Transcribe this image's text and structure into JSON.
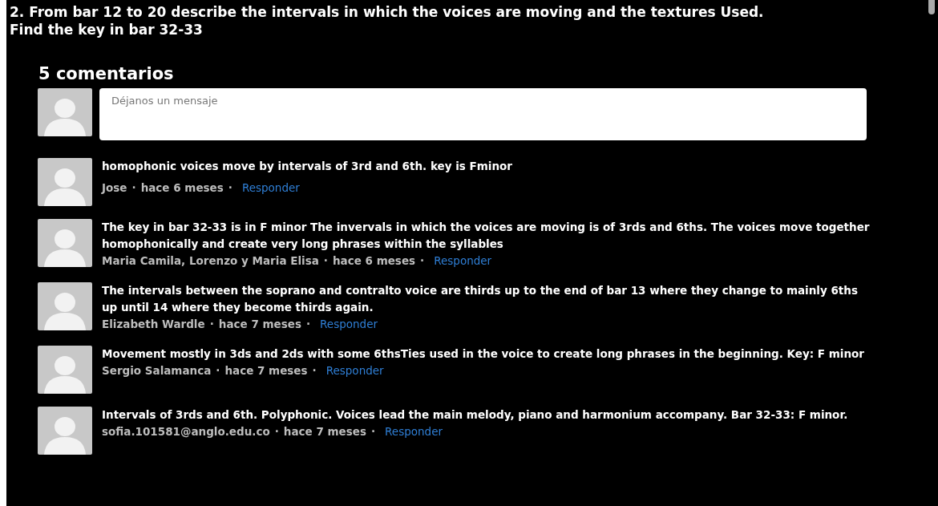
{
  "question": "2. From bar 12 to 20 describe the intervals in which the voices are moving and the textures Used. Find the key in bar 32-33",
  "comments_heading": "5 comentarios",
  "separator": "·",
  "message_field": {
    "placeholder": "Déjanos un mensaje"
  },
  "comments": [
    {
      "text": "homophonic voices move by intervals of 3rd and 6th. key is Fminor",
      "author": "Jose",
      "time": "hace 6 meses",
      "reply": "Responder"
    },
    {
      "text": "The key in bar 32-33 is in F minor The invervals in which the voices are moving is of 3rds and 6ths. The voices move together homophonically and create very long phrases within the syllables",
      "author": "Maria Camila, Lorenzo y Maria Elisa",
      "time": "hace 6 meses",
      "reply": "Responder"
    },
    {
      "text": "The intervals between the soprano and contralto voice are thirds up to the end of bar 13 where they change to mainly 6ths up until 14 where they become thirds again.",
      "author": "Elizabeth Wardle",
      "time": "hace 7 meses",
      "reply": "Responder"
    },
    {
      "text": "Movement mostly in 3ds and 2ds with some 6thsTies used in the voice to create long phrases in the beginning. Key: F minor",
      "author": "Sergio Salamanca",
      "time": "hace 7 meses",
      "reply": "Responder"
    },
    {
      "text": "Intervals of 3rds and 6th. Polyphonic. Voices lead the main melody, piano and harmonium accompany. Bar 32-33: F minor.",
      "author": "sofia.101581@anglo.edu.co",
      "time": "hace 7 meses",
      "reply": "Responder"
    }
  ]
}
